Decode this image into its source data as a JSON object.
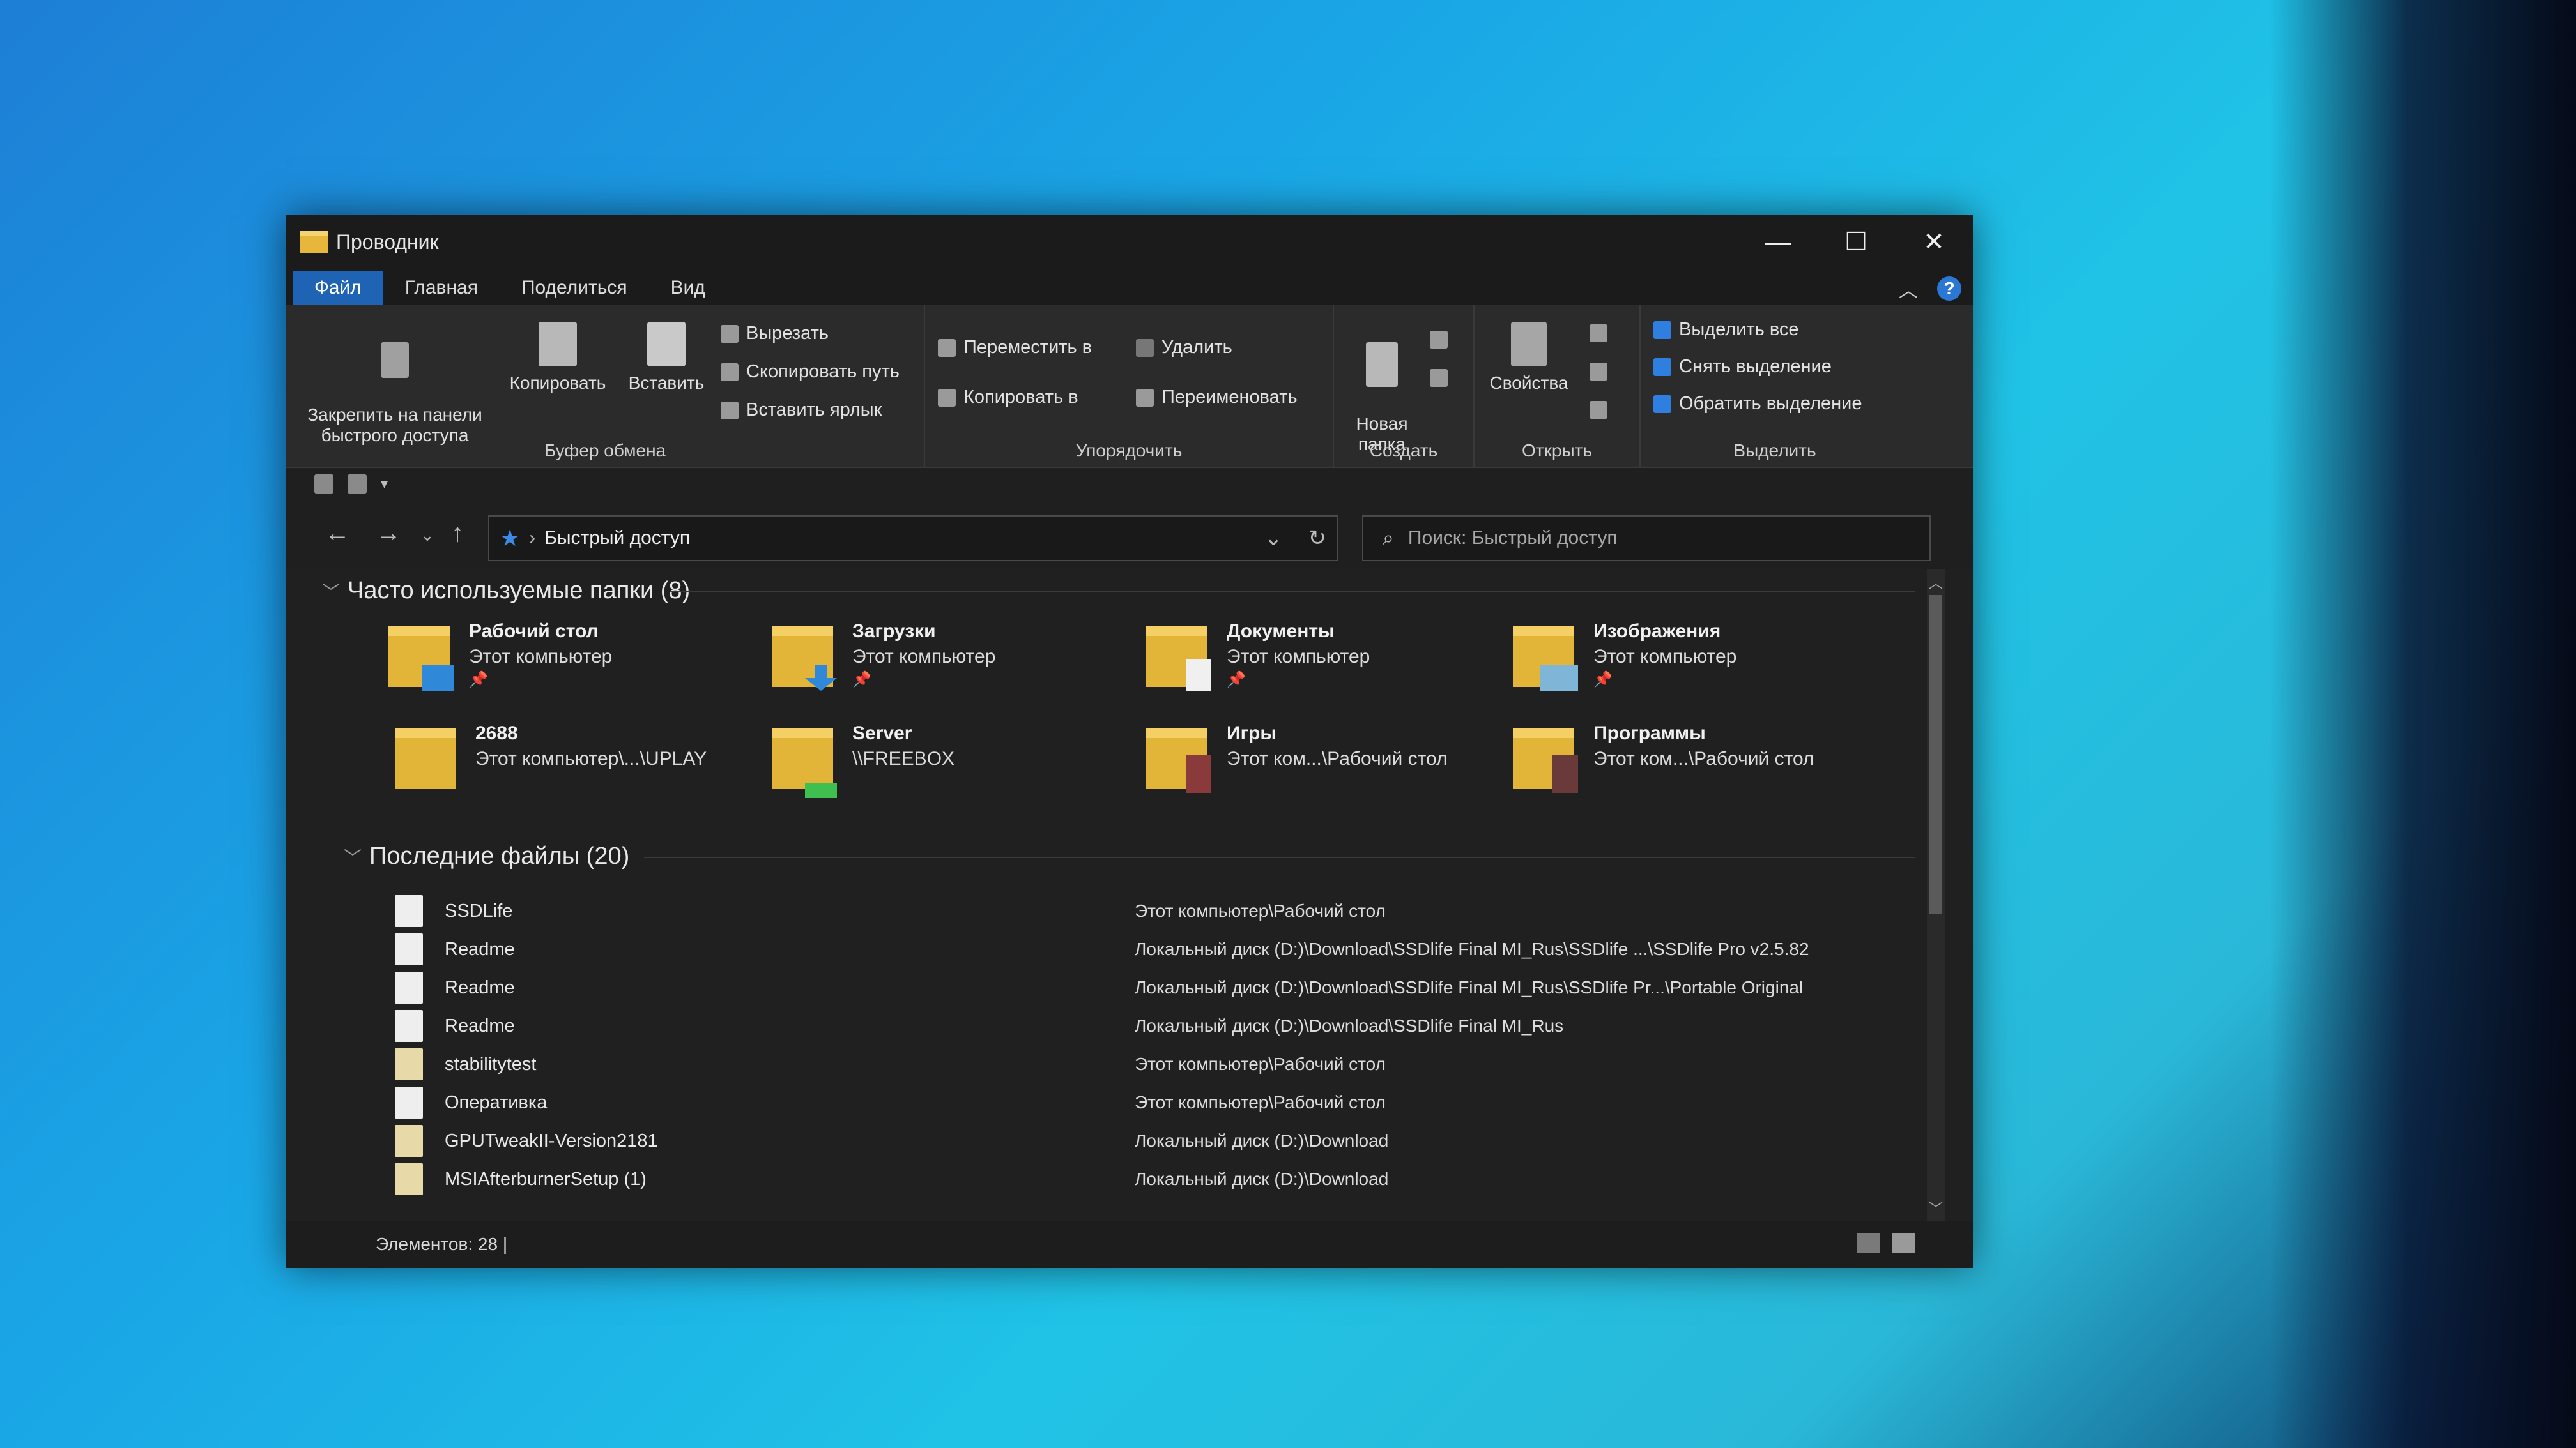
{
  "window": {
    "title": "Проводник",
    "controls": {
      "minimize": "—",
      "maximize": "☐",
      "close": "✕"
    }
  },
  "tabs": [
    "Файл",
    "Главная",
    "Поделиться",
    "Вид"
  ],
  "ribbon": {
    "clipboard": {
      "pin": "Закрепить на панели\nбыстрого доступа",
      "copy": "Копировать",
      "paste": "Вставить",
      "cut": "Вырезать",
      "copy_path": "Скопировать путь",
      "paste_shortcut": "Вставить ярлык",
      "label": "Буфер обмена"
    },
    "organize": {
      "move_to": "Переместить в",
      "copy_to": "Копировать в",
      "delete": "Удалить",
      "rename": "Переименовать",
      "label": "Упорядочить"
    },
    "create": {
      "new_folder": "Новая\nпапка",
      "label": "Создать"
    },
    "open": {
      "properties": "Свойства",
      "label": "Открыть"
    },
    "select": {
      "select_all": "Выделить все",
      "select_none": "Снять выделение",
      "invert": "Обратить выделение",
      "label": "Выделить"
    }
  },
  "address": {
    "path": "Быстрый доступ"
  },
  "search": {
    "placeholder": "Поиск: Быстрый доступ"
  },
  "frequent": {
    "header": "Часто используемые папки (8)",
    "items": [
      {
        "name": "Рабочий стол",
        "path": "Этот компьютер",
        "pinned": true
      },
      {
        "name": "Загрузки",
        "path": "Этот компьютер",
        "pinned": true
      },
      {
        "name": "Документы",
        "path": "Этот компьютер",
        "pinned": true
      },
      {
        "name": "Изображения",
        "path": "Этот компьютер",
        "pinned": true
      },
      {
        "name": "2688",
        "path": "Этот компьютер\\...\\UPLAY",
        "pinned": false
      },
      {
        "name": "Server",
        "path": "\\\\FREEBOX",
        "pinned": false
      },
      {
        "name": "Игры",
        "path": "Этот ком...\\Рабочий стол",
        "pinned": false
      },
      {
        "name": "Программы",
        "path": "Этот ком...\\Рабочий стол",
        "pinned": false
      }
    ]
  },
  "recent": {
    "header": "Последние файлы (20)",
    "items": [
      {
        "name": "SSDLife",
        "path": "Этот компьютер\\Рабочий стол"
      },
      {
        "name": "Readme",
        "path": "Локальный диск (D:)\\Download\\SSDlife Final MI_Rus\\SSDlife ...\\SSDlife Pro v2.5.82"
      },
      {
        "name": "Readme",
        "path": "Локальный диск (D:)\\Download\\SSDlife Final MI_Rus\\SSDlife Pr...\\Portable Original"
      },
      {
        "name": "Readme",
        "path": "Локальный диск (D:)\\Download\\SSDlife Final MI_Rus"
      },
      {
        "name": "stabilitytest",
        "path": "Этот компьютер\\Рабочий стол"
      },
      {
        "name": "Оперативка",
        "path": "Этот компьютер\\Рабочий стол"
      },
      {
        "name": "GPUTweakII-Version2181",
        "path": "Локальный диск (D:)\\Download"
      },
      {
        "name": "MSIAfterburnerSetup (1)",
        "path": "Локальный диск (D:)\\Download"
      }
    ]
  },
  "status": {
    "items": "Элементов: 28  |"
  },
  "icons": {
    "pin": "pin-icon",
    "copy": "copy-icon",
    "paste": "paste-icon",
    "cut": "scissors-icon",
    "back": "arrow-left-icon",
    "forward": "arrow-right-icon",
    "up": "arrow-up-icon",
    "refresh": "refresh-icon",
    "search": "search-icon",
    "help": "help-icon"
  }
}
